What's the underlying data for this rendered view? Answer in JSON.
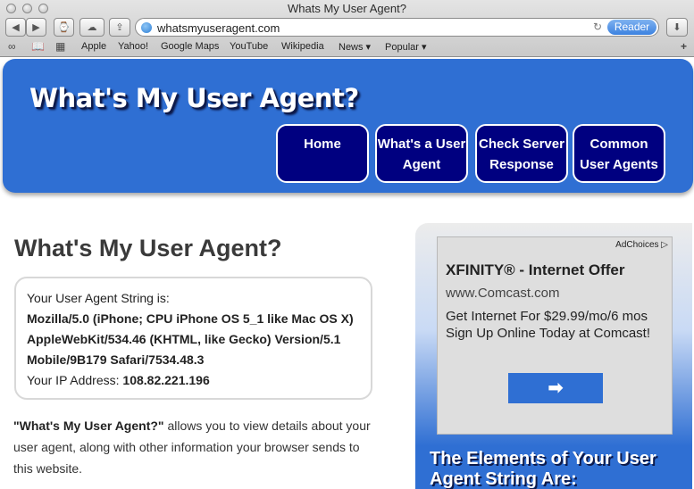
{
  "browser": {
    "window_title": "Whats My User Agent?",
    "url": "whatsmyuseragent.com",
    "reader_label": "Reader",
    "reload_glyph": "↻",
    "bookmarks": [
      "Apple",
      "Yahoo!",
      "Google Maps",
      "YouTube",
      "Wikipedia",
      "News ▾",
      "Popular ▾"
    ],
    "icons": {
      "back": "◀",
      "forward": "▶",
      "history": "⌚",
      "cloud": "☁",
      "share": "⇪",
      "reading-list": "∞",
      "bookmarks-book": "📖",
      "top-sites": "▦",
      "downloads": "⬇",
      "add-tab": "+"
    }
  },
  "header": {
    "site_title": "What's My User Agent?",
    "nav": [
      "Home",
      "What's a User Agent",
      "Check Server Response",
      "Common User Agents"
    ]
  },
  "main": {
    "title": "What's My User Agent?",
    "ua_label": "Your User Agent String is:",
    "ua_lines": [
      "Mozilla/5.0 (iPhone; CPU iPhone OS 5_1 like Mac OS X)",
      "AppleWebKit/534.46 (KHTML, like Gecko) Version/5.1",
      "Mobile/9B179 Safari/7534.48.3"
    ],
    "ip_label": "Your IP Address:",
    "ip_value": "108.82.221.196",
    "intro_bold": "\"What's My User Agent?\"",
    "intro_rest": "allows you to view details about your user agent, along with other information your browser sends to this website."
  },
  "sidebar": {
    "ad": {
      "choices": "AdChoices ▷",
      "headline": "XFINITY® - Internet Offer",
      "url": "www.Comcast.com",
      "body": "Get Internet For $29.99/mo/6 mos Sign Up Online Today at Comcast!",
      "arrow": "➡"
    },
    "heading": "The Elements of Your User Agent String Are:"
  },
  "colors": {
    "header_blue": "#2f6fd3",
    "nav_navy": "#000080"
  }
}
